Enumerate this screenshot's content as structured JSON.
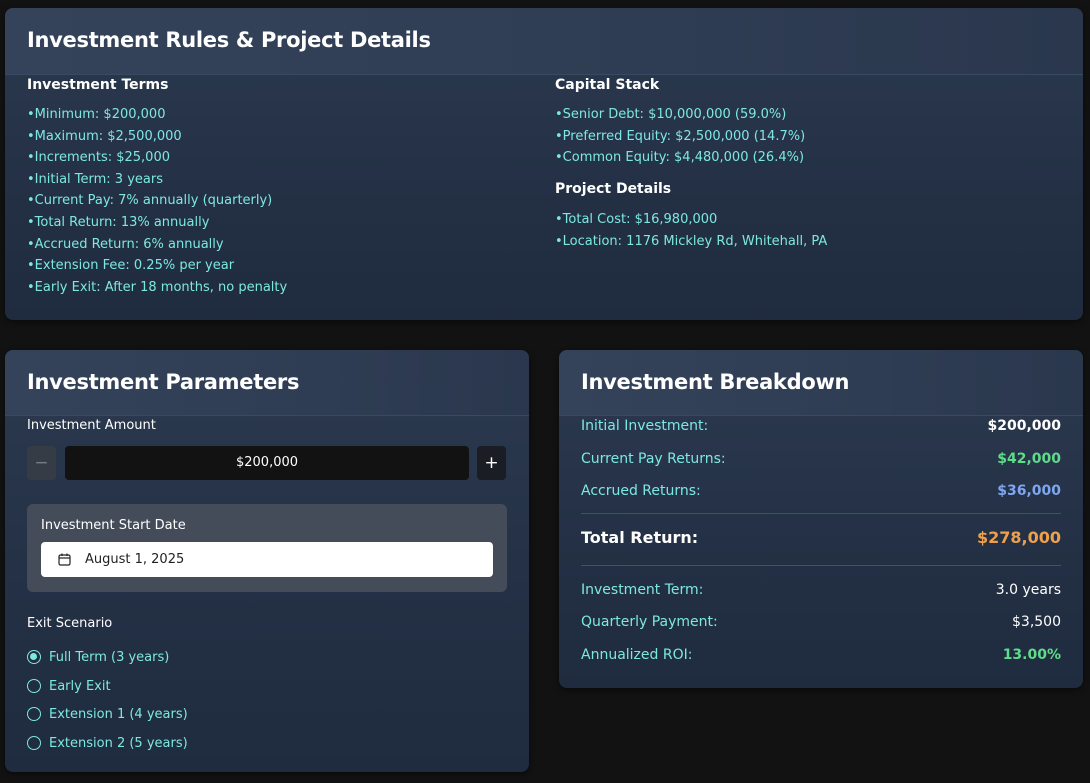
{
  "rules": {
    "title": "Investment Rules & Project Details",
    "terms_title": "Investment Terms",
    "terms": [
      "Minimum: $200,000",
      "Maximum: $2,500,000",
      "Increments: $25,000",
      "Initial Term: 3 years",
      "Current Pay: 7% annually (quarterly)",
      "Total Return: 13% annually",
      "Accrued Return: 6% annually",
      "Extension Fee: 0.25% per year",
      "Early Exit: After 18 months, no penalty"
    ],
    "capital_title": "Capital Stack",
    "capital": [
      "Senior Debt: $10,000,000 (59.0%)",
      "Preferred Equity: $2,500,000 (14.7%)",
      "Common Equity: $4,480,000 (26.4%)"
    ],
    "project_title": "Project Details",
    "project": [
      "Total Cost: $16,980,000",
      "Location: 1176 Mickley Rd, Whitehall, PA"
    ]
  },
  "params": {
    "title": "Investment Parameters",
    "amount_label": "Investment Amount",
    "minus": "−",
    "plus": "+",
    "amount_value": "$200,000",
    "start_date_label": "Investment Start Date",
    "start_date_value": "August 1, 2025",
    "exit_label": "Exit Scenario",
    "exit_options": [
      {
        "label": "Full Term (3 years)",
        "checked": true
      },
      {
        "label": "Early Exit",
        "checked": false
      },
      {
        "label": "Extension 1 (4 years)",
        "checked": false
      },
      {
        "label": "Extension 2 (5 years)",
        "checked": false
      }
    ]
  },
  "breakdown": {
    "title": "Investment Breakdown",
    "initial_label": "Initial Investment:",
    "initial_value": "$200,000",
    "current_pay_label": "Current Pay Returns:",
    "current_pay_value": "$42,000",
    "accrued_label": "Accrued Returns:",
    "accrued_value": "$36,000",
    "total_label": "Total Return:",
    "total_value": "$278,000",
    "term_label": "Investment Term:",
    "term_value": "3.0 years",
    "quarterly_label": "Quarterly Payment:",
    "quarterly_value": "$3,500",
    "roi_label": "Annualized ROI:",
    "roi_value": "13.00%"
  },
  "colors": {
    "accent_teal": "#7de8e0",
    "green": "#5fdc8a",
    "blue": "#7fa6f0",
    "orange": "#f0a04b",
    "white": "#ffffff"
  }
}
